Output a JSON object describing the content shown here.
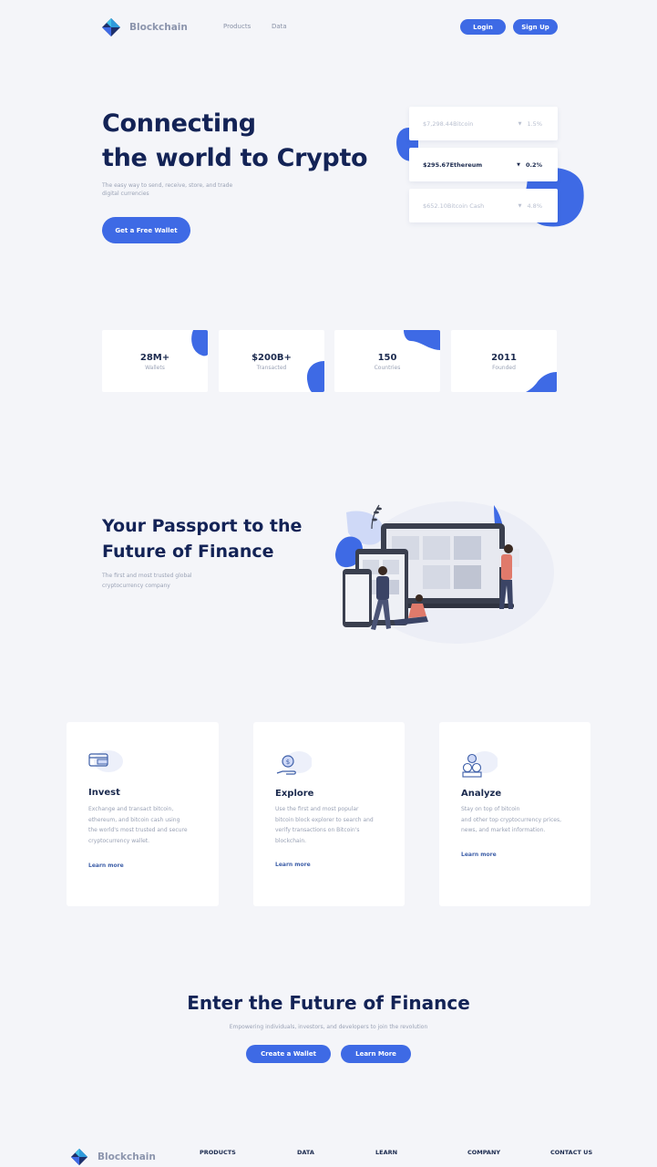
{
  "header": {
    "brand": "Blockchain",
    "nav": [
      "Products",
      "Data"
    ],
    "login": "Login",
    "signup": "Sign Up"
  },
  "hero": {
    "title_line1": "Connecting",
    "title_line2": "the world to Crypto",
    "subtitle_line1": "The easy way to send, receive, store, and trade",
    "subtitle_line2": "digital currencies",
    "cta": "Get a Free Wallet"
  },
  "tickers": [
    {
      "price": "$7,298.44",
      "name": "Bitcoin",
      "change": "1.5%"
    },
    {
      "price": "$295.67",
      "name": "Ethereum",
      "change": "0.2%"
    },
    {
      "price": "$652.10",
      "name": "Bitcoin Cash",
      "change": "4.8%"
    }
  ],
  "stats": [
    {
      "value": "28M+",
      "label": "Wallets"
    },
    {
      "value": "$200B+",
      "label": "Transacted"
    },
    {
      "value": "150",
      "label": "Countries"
    },
    {
      "value": "2011",
      "label": "Founded"
    }
  ],
  "passport": {
    "title_line1": "Your Passport to the",
    "title_line2": "Future of Finance",
    "sub_line1": "The first and most trusted global",
    "sub_line2": "cryptocurrency company"
  },
  "features": [
    {
      "icon": "wallet-icon",
      "title": "Invest",
      "desc": [
        "Exchange and transact bitcoin,",
        "ethereum, and bitcoin cash using",
        "the world's most trusted and secure",
        "cryptocurrency wallet."
      ],
      "link": "Learn more"
    },
    {
      "icon": "coin-hand-icon",
      "title": "Explore",
      "desc": [
        "Use the first and most popular",
        "bitcoin block explorer to search and",
        "verify transactions on Bitcoin's",
        "blockchain."
      ],
      "link": "Learn more"
    },
    {
      "icon": "coins-stack-icon",
      "title": "Analyze",
      "desc": [
        "Stay on top of bitcoin",
        "and other top cryptocurrency prices,",
        "news, and market information."
      ],
      "link": "Learn more"
    }
  ],
  "future": {
    "title": "Enter the Future of Finance",
    "subtitle": "Empowering individuals, investors, and developers to join the revolution",
    "create": "Create a Wallet",
    "learn": "Learn More"
  },
  "footer": {
    "brand": "Blockchain",
    "links": [
      "PRODUCTS",
      "DATA",
      "LEARN",
      "COMPANY",
      "CONTACT US"
    ]
  },
  "colors": {
    "accent": "#3e6ae5",
    "navy": "#132356",
    "bg": "#f4f5f9"
  }
}
